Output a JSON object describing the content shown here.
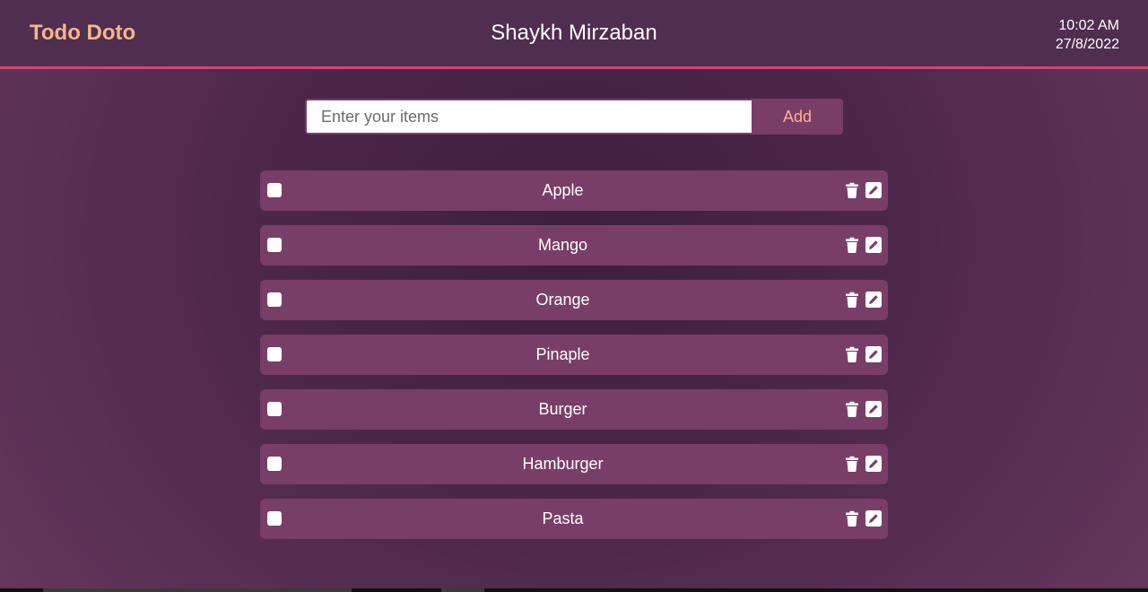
{
  "header": {
    "brand": "Todo Doto",
    "user_name": "Shaykh Mirzaban",
    "time": "10:02 AM",
    "date": "27/8/2022"
  },
  "add_form": {
    "placeholder": "Enter your items",
    "value": "",
    "button_label": "Add"
  },
  "todos": [
    {
      "text": "Apple",
      "checked": false
    },
    {
      "text": "Mango",
      "checked": false
    },
    {
      "text": "Orange",
      "checked": false
    },
    {
      "text": "Pinaple",
      "checked": false
    },
    {
      "text": "Burger",
      "checked": false
    },
    {
      "text": "Hamburger",
      "checked": false
    },
    {
      "text": "Pasta",
      "checked": false
    }
  ],
  "icons": {
    "delete": "trash-icon",
    "edit": "pencil-icon"
  },
  "colors": {
    "brand": "#f7b58a",
    "accent_border": "#d4456f",
    "item_bg": "#783e68",
    "header_bg": "#4f2e50"
  }
}
